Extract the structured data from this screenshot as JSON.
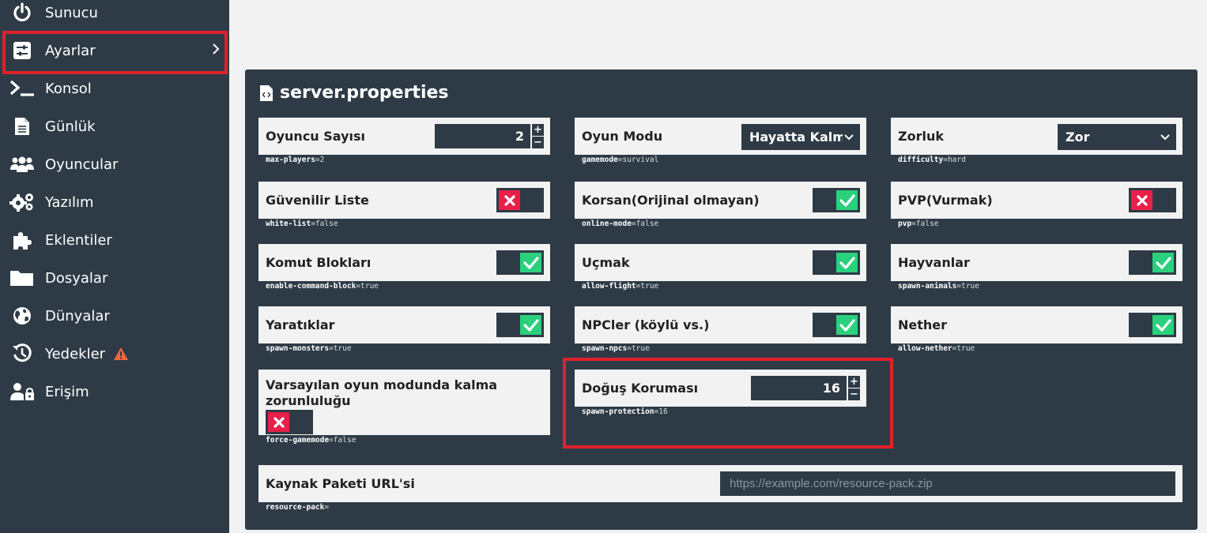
{
  "sidebar": {
    "items": [
      {
        "label": "Sunucu",
        "icon": "power-icon"
      },
      {
        "label": "Ayarlar",
        "icon": "sliders-icon",
        "active": true
      },
      {
        "label": "Konsol",
        "icon": "terminal-icon"
      },
      {
        "label": "Günlük",
        "icon": "log-file-icon"
      },
      {
        "label": "Oyuncular",
        "icon": "users-icon"
      },
      {
        "label": "Yazılım",
        "icon": "gears-icon"
      },
      {
        "label": "Eklentiler",
        "icon": "puzzle-icon"
      },
      {
        "label": "Dosyalar",
        "icon": "folder-icon"
      },
      {
        "label": "Dünyalar",
        "icon": "globe-icon"
      },
      {
        "label": "Yedekler",
        "icon": "history-icon",
        "badge": "warning-icon"
      },
      {
        "label": "Erişim",
        "icon": "user-lock-icon"
      }
    ]
  },
  "panel": {
    "title": "server.properties",
    "settings": {
      "max_players": {
        "label": "Oyuncu Sayısı",
        "key": "max-players",
        "value": "2"
      },
      "gamemode": {
        "label": "Oyun Modu",
        "key": "gamemode",
        "value": "survival",
        "selected": "Hayatta Kalma"
      },
      "difficulty": {
        "label": "Zorluk",
        "key": "difficulty",
        "value": "hard",
        "selected": "Zor"
      },
      "white_list": {
        "label": "Güvenilir Liste",
        "key": "white-list",
        "value": "false"
      },
      "online_mode": {
        "label": "Korsan(Orijinal olmayan)",
        "key": "online-mode",
        "value": "false"
      },
      "pvp": {
        "label": "PVP(Vurmak)",
        "key": "pvp",
        "value": "false"
      },
      "command_block": {
        "label": "Komut Blokları",
        "key": "enable-command-block",
        "value": "true"
      },
      "allow_flight": {
        "label": "Uçmak",
        "key": "allow-flight",
        "value": "true"
      },
      "spawn_animals": {
        "label": "Hayvanlar",
        "key": "spawn-animals",
        "value": "true"
      },
      "spawn_monsters": {
        "label": "Yaratıklar",
        "key": "spawn-monsters",
        "value": "true"
      },
      "spawn_npcs": {
        "label": "NPCler (köylü vs.)",
        "key": "spawn-npcs",
        "value": "true"
      },
      "allow_nether": {
        "label": "Nether",
        "key": "allow-nether",
        "value": "true"
      },
      "force_gamemode": {
        "label": "Varsayılan oyun modunda kalma zorunluluğu",
        "key": "force-gamemode",
        "value": "false"
      },
      "spawn_protection": {
        "label": "Doğuş Koruması",
        "key": "spawn-protection",
        "value": "16"
      },
      "resource_pack": {
        "label": "Kaynak Paketi URL'si",
        "key": "resource-pack",
        "value": "",
        "placeholder": "https://example.com/resource-pack.zip"
      }
    },
    "eq": "=",
    "stepper_plus": "+",
    "stepper_minus": "−"
  },
  "colors": {
    "sidebar_bg": "#2e3b46",
    "card_bg": "#f2f2f2",
    "toggle_on": "#2bd07d",
    "toggle_off": "#e8204a",
    "highlight": "#e0202c"
  }
}
